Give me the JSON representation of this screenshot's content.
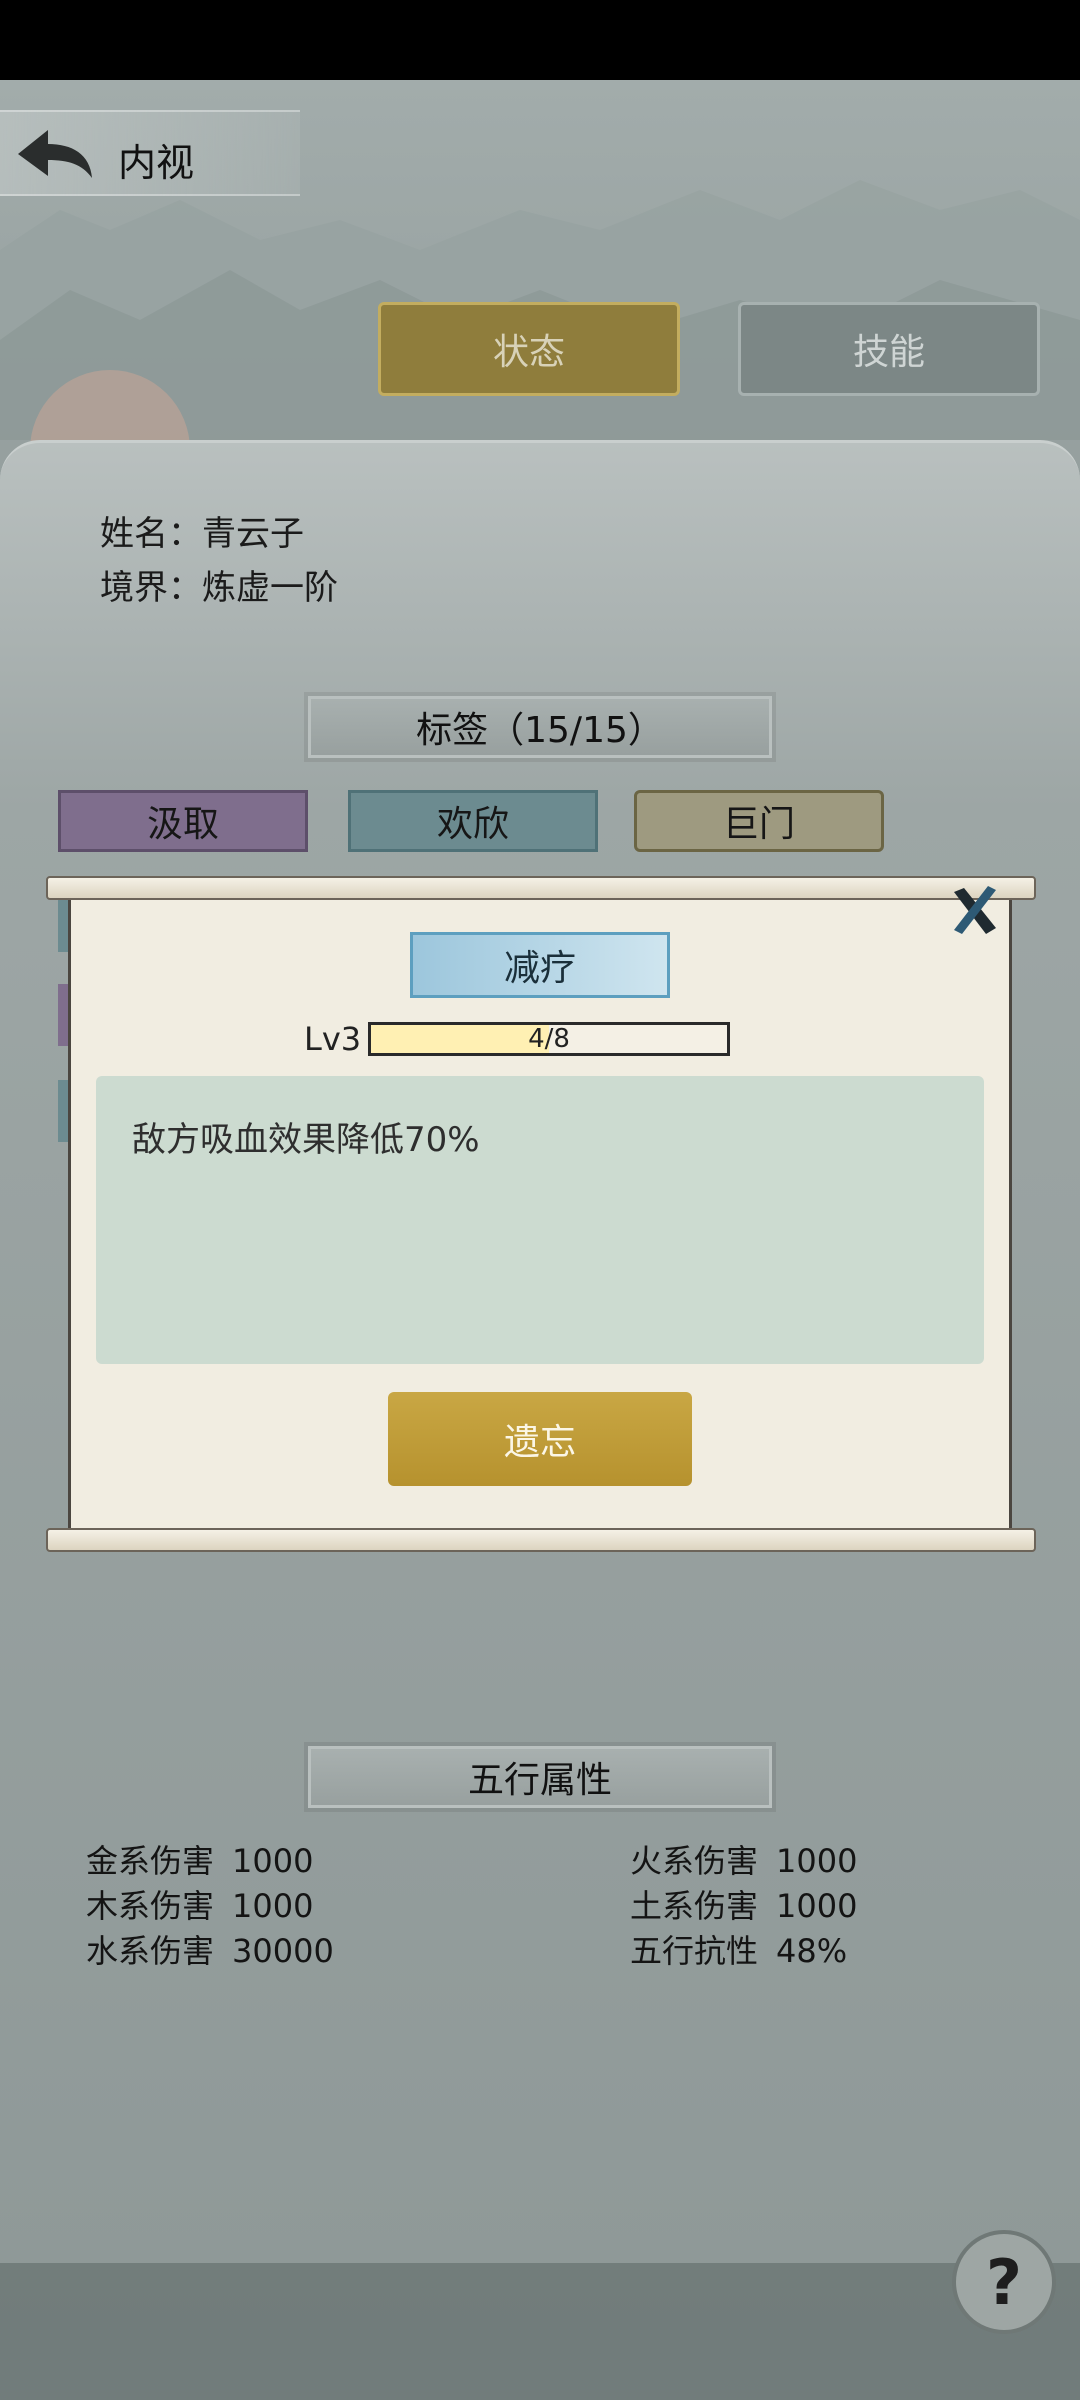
{
  "header": {
    "title": "内视"
  },
  "tabs": [
    {
      "label": "状态",
      "active": true
    },
    {
      "label": "技能",
      "active": false
    }
  ],
  "character": {
    "name_label": "姓名：青云子",
    "realm_label": "境界：炼虚一阶"
  },
  "tags": {
    "title": "标签（15/15）",
    "items": [
      "汲取",
      "欢欣",
      "巨门"
    ]
  },
  "modal": {
    "skill_name": "减疗",
    "level": "Lv3",
    "exp_text": "4/8",
    "exp_current": 4,
    "exp_max": 8,
    "description": "敌方吸血效果降低70%",
    "forget_label": "遗忘"
  },
  "elements": {
    "title": "五行属性",
    "left": [
      {
        "label": "金系伤害",
        "value": "1000"
      },
      {
        "label": "木系伤害",
        "value": "1000"
      },
      {
        "label": "水系伤害",
        "value": "30000"
      }
    ],
    "right": [
      {
        "label": "火系伤害",
        "value": "1000"
      },
      {
        "label": "土系伤害",
        "value": "1000"
      },
      {
        "label": "五行抗性",
        "value": "48%"
      }
    ]
  },
  "help": {
    "label": "?"
  },
  "colors": {
    "active_tab": "#8f7d3c",
    "forget_button": "#c3a03d",
    "skill_badge": "#a8cfe2",
    "desc_box": "#ccdbd0"
  }
}
